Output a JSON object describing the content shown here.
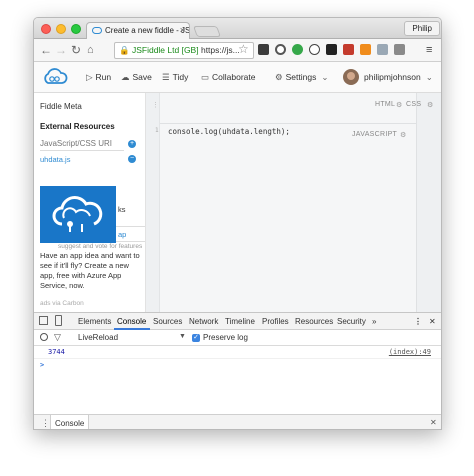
{
  "browser": {
    "tab_title": "Create a new fiddle - JSFid",
    "tab_close": "×",
    "profile_name": "Philip",
    "url_org": "JSFiddle Ltd [GB]",
    "url_text": "https://js..."
  },
  "appbar": {
    "run": "Run",
    "save": "Save",
    "tidy": "Tidy",
    "collaborate": "Collaborate",
    "settings": "Settings",
    "username": "philipmjohnson"
  },
  "sidebar": {
    "meta": "Fiddle Meta",
    "external_resources": "External Resources",
    "url_placeholder": "JavaScript/CSS URI",
    "resource": "uhdata.js",
    "ad_partial_1": "ks",
    "ad_partial_2": "ap",
    "ad_partial_3": "suggest and vote for features",
    "ad_text": "Have an app idea and want to see if it'll fly? Create a new app, free with Azure App Service, now.",
    "ad_via": "ads via Carbon"
  },
  "editor": {
    "html_label": "HTML",
    "css_label": "CSS",
    "js_label": "JAVASCRIPT",
    "line_number": "1",
    "code": "console.log(uhdata.length);"
  },
  "devtools": {
    "tabs": [
      "Elements",
      "Console",
      "Sources",
      "Network",
      "Timeline",
      "Profiles",
      "Resources",
      "Security",
      "»"
    ],
    "context": "LiveReload",
    "preserve_log": "Preserve log",
    "output_value": "3744",
    "output_source": "(index):49",
    "prompt": ">",
    "drawer_tab": "Console"
  },
  "colors": {
    "accent": "#2f8bd2",
    "azure": "#1976c8",
    "console_number": "#1a1aa6"
  }
}
